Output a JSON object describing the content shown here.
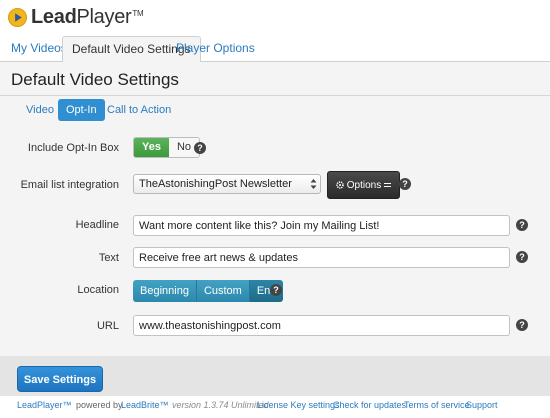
{
  "brand": {
    "name_bold": "Lead",
    "name_light": "Player",
    "tm": "TM"
  },
  "top_tabs": [
    {
      "label": "My Videos",
      "active": false
    },
    {
      "label": "Default Video Settings",
      "active": true
    },
    {
      "label": "Player Options",
      "active": false
    }
  ],
  "page": {
    "title": "Default Video Settings",
    "sub_tabs": [
      {
        "label": "Video",
        "active": false
      },
      {
        "label": "Opt-In",
        "active": true
      },
      {
        "label": "Call to Action",
        "active": false
      }
    ]
  },
  "form": {
    "include_optin": {
      "label": "Include Opt-In Box",
      "yes": "Yes",
      "no": "No",
      "selected": "Yes"
    },
    "email_list": {
      "label": "Email list integration",
      "selected": "TheAstonishingPost Newsletter",
      "options_button": "Options"
    },
    "headline": {
      "label": "Headline",
      "value": "Want more content like this? Join my Mailing List!"
    },
    "text": {
      "label": "Text",
      "value": "Receive free art news & updates"
    },
    "location": {
      "label": "Location",
      "options": [
        "Beginning",
        "Custom",
        "End"
      ],
      "selected": "End"
    },
    "url": {
      "label": "URL",
      "value": "www.theastonishingpost.com"
    },
    "help_glyph": "?"
  },
  "footer": {
    "save_label": "Save Settings",
    "product": "LeadPlayer™",
    "powered_by": "powered by",
    "company": "LeadBrite™",
    "version": "version 1.3.74 Unlimited",
    "links": [
      "License Key settings",
      "Check for updates",
      "Terms of service",
      "Support"
    ]
  },
  "colors": {
    "link": "#2a7bbf",
    "active_subtab": "#2f8fd0",
    "yes_green": "#4aa84a",
    "location_teal": "#3a98bc",
    "save_blue": "#2684cf",
    "panel_bg": "#f4f4f4",
    "logo_yellow": "#f2b51b"
  },
  "icons": {
    "logo": "play-button-logo",
    "help": "question-circle-icon",
    "gear": "gear-icon",
    "select": "select-arrows-icon"
  }
}
